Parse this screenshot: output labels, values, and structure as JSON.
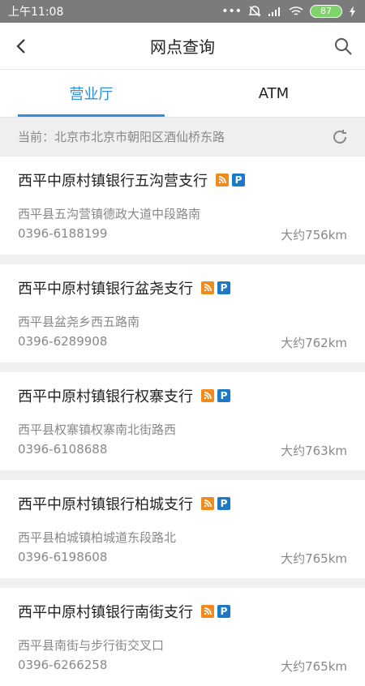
{
  "status_bar": {
    "time": "上午11:08",
    "battery": "87"
  },
  "header": {
    "title": "网点查询"
  },
  "tabs": [
    {
      "label": "营业厅"
    },
    {
      "label": "ATM"
    }
  ],
  "current_location": "当前：北京市北京市朝阳区酒仙桥东路",
  "branches": [
    {
      "name": "西平中原村镇银行五沟营支行",
      "address": "西平县五沟营镇德政大道中段路南",
      "phone": "0396-6188199",
      "distance": "大约756km"
    },
    {
      "name": "西平中原村镇银行盆尧支行",
      "address": "西平县盆尧乡西五路南",
      "phone": "0396-6289908",
      "distance": "大约762km"
    },
    {
      "name": "西平中原村镇银行权寨支行",
      "address": "西平县权寨镇权寨南北街路西",
      "phone": "0396-6108688",
      "distance": "大约763km"
    },
    {
      "name": "西平中原村镇银行柏城支行",
      "address": "西平县柏城镇柏城道东段路北",
      "phone": "0396-6198608",
      "distance": "大约765km"
    },
    {
      "name": "西平中原村镇银行南街支行",
      "address": "西平县南街与步行街交叉口",
      "phone": "0396-6266258",
      "distance": "大约765km"
    }
  ],
  "badges": {
    "parking_label": "P"
  }
}
